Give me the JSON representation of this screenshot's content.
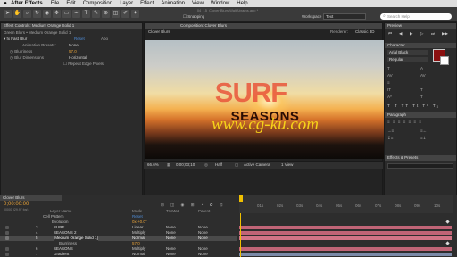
{
  "menubar": {
    "apple": "",
    "app": "After Effects",
    "items": [
      "File",
      "Edit",
      "Composition",
      "Layer",
      "Effect",
      "Animation",
      "View",
      "Window",
      "Help"
    ]
  },
  "toolbar": {
    "snapping": "Snapping",
    "window_title": "04_15_Clover Blurs WaltAbrams.aep *",
    "workspace_label": "Workspace",
    "workspace": "Text",
    "search_placeholder": "Search Help"
  },
  "effect_controls": {
    "tab": "Effect Controls: Medium Orange Solid 1",
    "subtitle": "Green Blurs • Medium Orange Solid 1",
    "effect_name": "Fast Blur",
    "reset": "Reset",
    "about": "Abo",
    "anim_presets_label": "Animation Presets:",
    "anim_presets_value": "None",
    "blurriness_label": "Blurriness",
    "blurriness_value": "57.0",
    "blur_dim_label": "Blur Dimensions",
    "blur_dim_value": "Horizontal",
    "repeat_label": "Repeat Edge Pixels"
  },
  "composition": {
    "tab": "Composition: Clover Blurs",
    "subtab": "Clover Blurs",
    "renderer_label": "Renderer:",
    "renderer": "Classic 3D",
    "title": "SURF",
    "subtitle": "SEASONS",
    "watermark": "www.cg-ku.com",
    "footer": {
      "zoom": "66.6%",
      "timecode": "0;00;03;10",
      "resolution": "Half",
      "camera": "Active Camera",
      "views": "1 View"
    }
  },
  "right_panel": {
    "preview_tab": "Preview",
    "character_tab": "Character",
    "font": "Arial Black",
    "style": "Regular",
    "paragraph_tab": "Paragraph",
    "effects_tab": "Effects & Presets"
  },
  "timeline": {
    "tab": "Clover Blurs",
    "timecode": "0;00:00:00",
    "fps": "00000 (29.97 fps)",
    "col_layer": "Layer Name",
    "col_mode": "Mode",
    "col_trkmat": "TrkMat",
    "col_parent": "Parent",
    "layers": [
      {
        "num": "",
        "name": "Cell Pattern",
        "mode": "",
        "value": "Reset",
        "trk": "",
        "parent": ""
      },
      {
        "num": "",
        "name": "Evolution",
        "mode": "",
        "value": "0x +0.0°",
        "trk": "",
        "parent": ""
      },
      {
        "num": "3",
        "name": "SURF",
        "mode": "Linear L",
        "value": "",
        "trk": "None",
        "parent": "None"
      },
      {
        "num": "4",
        "name": "SEASONS 2",
        "mode": "Multiply",
        "value": "",
        "trk": "None",
        "parent": "None"
      },
      {
        "num": "5",
        "name": "[Medium Orange Solid 1]",
        "mode": "Normal",
        "value": "",
        "trk": "None",
        "parent": "None"
      },
      {
        "num": "",
        "name": "Blurriness",
        "mode": "",
        "value": "57.0",
        "trk": "",
        "parent": ""
      },
      {
        "num": "6",
        "name": "SEASONS",
        "mode": "Multiply",
        "value": "",
        "trk": "None",
        "parent": "None"
      },
      {
        "num": "7",
        "name": "Gradient",
        "mode": "Normal",
        "value": "",
        "trk": "None",
        "parent": "None"
      },
      {
        "num": "8",
        "name": "[Sunset.jpg]",
        "mode": "Normal",
        "value": "",
        "trk": "None",
        "parent": "None"
      }
    ],
    "bottom_bar": "Toggle Switches / Modes",
    "ruler": [
      "0s",
      "01s",
      "02s",
      "03s",
      "04s",
      "05s",
      "06s",
      "07s",
      "08s",
      "09s",
      "10s"
    ]
  },
  "colors": {
    "track_red": "#c06476",
    "track_blue": "#7b8aa8",
    "value_blue": "#4f8cd6",
    "value_orange": "#e9a339",
    "indicator_yellow": "#f0c000"
  }
}
